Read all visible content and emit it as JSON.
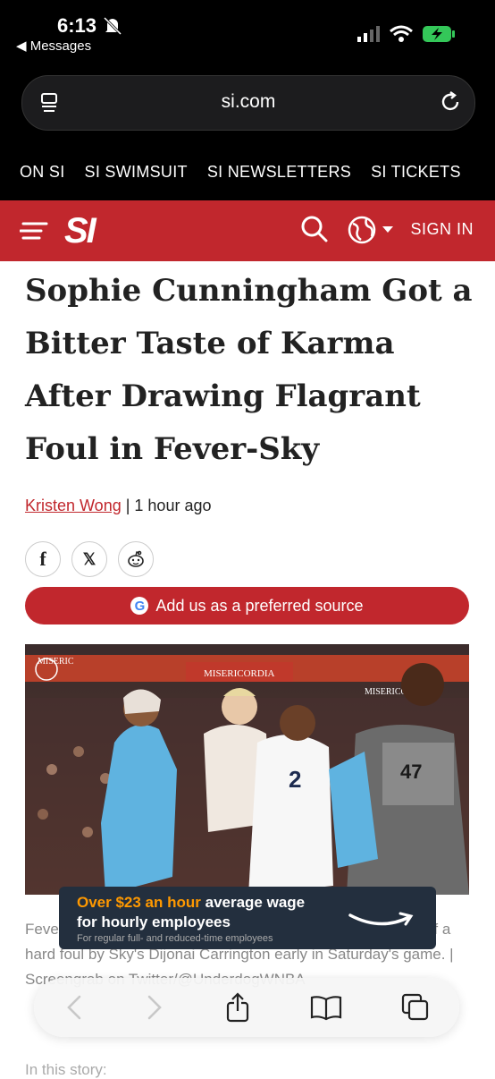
{
  "status": {
    "time": "6:13",
    "back_label": "◀ Messages"
  },
  "browser": {
    "url": "si.com"
  },
  "top_nav": [
    "ON SI",
    "SI SWIMSUIT",
    "SI NEWSLETTERS",
    "SI TICKETS"
  ],
  "header": {
    "logo": "SI",
    "signin": "SIGN IN"
  },
  "article": {
    "headline": "Sophie Cunningham Got a Bitter Taste of Karma After Drawing Flagrant Foul in Fever-Sky",
    "author": "Kristen Wong",
    "separator": " | ",
    "time": "1 hour ago",
    "share": {
      "facebook": "f",
      "x": "𝕏",
      "reddit": "◕"
    },
    "preferred_source": "Add us as a preferred source",
    "photo": {
      "banner1": "MISERICORDIA",
      "banner2": "MISERICORDIA",
      "banner3": "MISERIC",
      "jersey1": "2",
      "jersey2": "47"
    },
    "caption": "Fever guard Sophie Cunningham was on the receiving end of a hard foul by Sky's Dijonai Carrington early in Saturday's game. | Screengrab on Twitter/@UnderdogWNBA",
    "intro": "In this story:"
  },
  "ad": {
    "line1_highlight": "Over $23 an hour",
    "line1_rest": " average wage",
    "line2": "for hourly employees",
    "line3": "For regular full- and reduced-time employees"
  },
  "colors": {
    "brand": "#c1272d",
    "black": "#000000"
  }
}
